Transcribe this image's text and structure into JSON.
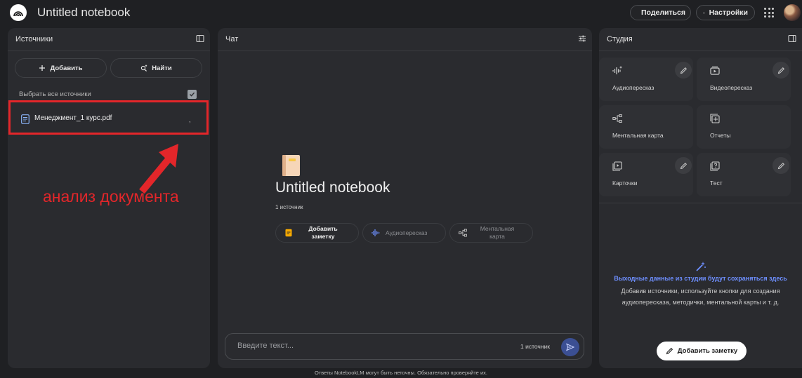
{
  "app": {
    "title": "Untitled notebook"
  },
  "header": {
    "share_label": "Поделиться",
    "settings_label": "Настройки"
  },
  "sources": {
    "title": "Источники",
    "add_label": "Добавить",
    "find_label": "Найти",
    "select_all_label": "Выбрать все источники",
    "select_all_checked": true,
    "items": [
      {
        "name": "Менеджмент_1 курс.pdf",
        "mark": ","
      }
    ]
  },
  "annotation": {
    "text": "анализ документа",
    "color": "#e3262a"
  },
  "chat": {
    "title": "Чат",
    "notebook_title": "Untitled notebook",
    "source_count": "1 источник",
    "chips": {
      "note": "Добавить заметку",
      "audio": "Аудиопересказ",
      "mind_map": "Ментальная карта"
    },
    "input_placeholder": "Введите текст...",
    "input_source_count": "1 источник"
  },
  "studio": {
    "title": "Студия",
    "cards": [
      {
        "label": "Аудиопересказ",
        "icon": "audio-wave-icon",
        "editable": true
      },
      {
        "label": "Видеопересказ",
        "icon": "video-icon",
        "editable": true
      },
      {
        "label": "Ментальная карта",
        "icon": "mind-map-icon",
        "editable": false
      },
      {
        "label": "Отчеты",
        "icon": "reports-icon",
        "editable": false
      },
      {
        "label": "Карточки",
        "icon": "flashcards-icon",
        "editable": true
      },
      {
        "label": "Тест",
        "icon": "quiz-icon",
        "editable": true
      }
    ],
    "hint_title": "Выходные данные из студии будут сохраняться здесь",
    "hint_body": "Добавив источники, используйте кнопки для создания аудиопересказа, методички, ментальной карты и т. д.",
    "add_note_label": "Добавить заметку"
  },
  "footer": {
    "disclaimer": "Ответы NotebookLM могут быть неточны. Обязательно проверяйте их."
  },
  "colors": {
    "background": "#1f2023",
    "panel": "#2a2b2f",
    "accent": "#6e8fff",
    "annotation": "#e3262a",
    "send": "#3b4f93"
  }
}
